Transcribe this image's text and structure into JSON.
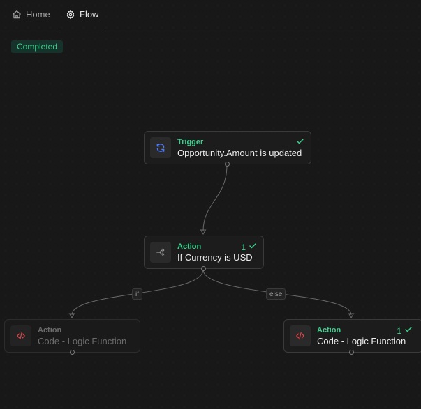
{
  "tabs": [
    {
      "label": "Home",
      "icon": "home-icon",
      "active": false
    },
    {
      "label": "Flow",
      "icon": "gear-icon",
      "active": true
    }
  ],
  "status": {
    "text": "Completed",
    "color": "#3ecf8e"
  },
  "nodes": {
    "trigger": {
      "kind": "Trigger",
      "label": "Opportunity.Amount is updated",
      "icon": "refresh-icon",
      "count": "",
      "check": true
    },
    "condition": {
      "kind": "Action",
      "label": "If Currency is USD",
      "icon": "branch-icon",
      "count": "1",
      "check": true
    },
    "action_if": {
      "kind": "Action",
      "label": "Code - Logic Function",
      "icon": "code-icon",
      "count": "",
      "check": false,
      "dimmed": true
    },
    "action_else": {
      "kind": "Action",
      "label": "Code - Logic Function",
      "icon": "code-icon",
      "count": "1",
      "check": true
    }
  },
  "edge_labels": {
    "if": "if",
    "else": "else"
  },
  "colors": {
    "accent": "#3ecf8e",
    "trigger_icon": "#4f7cff",
    "code_icon": "#e5484d",
    "background": "#181818"
  }
}
